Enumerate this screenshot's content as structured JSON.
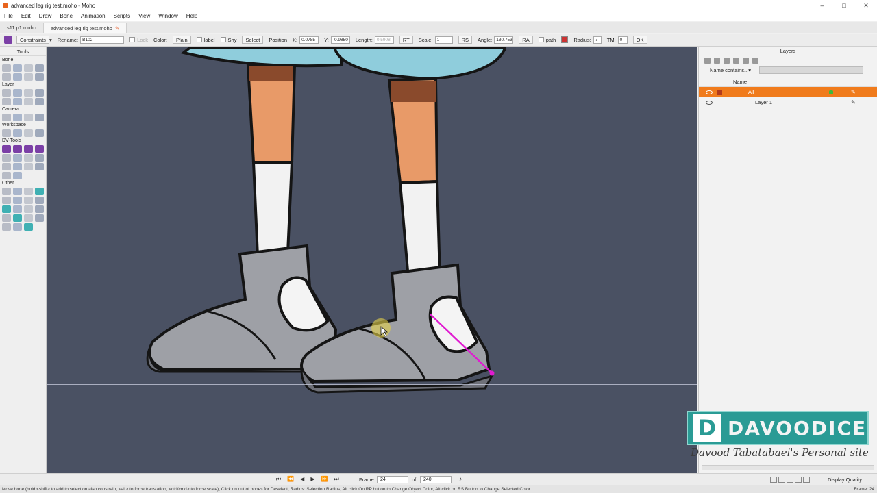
{
  "window": {
    "title": "advanced leg rig test.moho - Moho",
    "controls": {
      "minimize": "–",
      "maximize": "□",
      "close": "✕"
    }
  },
  "menu": [
    "File",
    "Edit",
    "Draw",
    "Bone",
    "Animation",
    "Scripts",
    "View",
    "Window",
    "Help"
  ],
  "tabs": [
    {
      "label": "s11 p1.moho",
      "active": false
    },
    {
      "label": "advanced leg rig test.moho",
      "active": true
    }
  ],
  "options": {
    "constraints": "Constraints",
    "rename_label": "Rename:",
    "rename_value": "B102",
    "lock": "Lock",
    "color_label": "Color:",
    "color_value": "Plain",
    "label": "label",
    "shy": "Shy",
    "select": "Select",
    "position_label": "Position",
    "x_label": "X:",
    "x_value": "0.0785",
    "y_label": "Y:",
    "y_value": "-0.9850",
    "length_label": "Length:",
    "length_value": "0.5908",
    "rt": "RT",
    "scale_label": "Scale:",
    "scale_value": "1",
    "rs": "RS",
    "angle_label": "Angle:",
    "angle_value": "130.753",
    "ra": "RA",
    "path": "path",
    "radius_label": "Radius:",
    "radius_value": "7",
    "tm_label": "TM:",
    "tm_value": "0",
    "ok": "OK"
  },
  "tools": {
    "header": "Tools",
    "sections": [
      {
        "name": "Bone",
        "icons": [
          "bone-select-icon",
          "bone-translate-icon",
          "bone-scale-icon",
          "bone-rotate-icon",
          "bone-add-icon",
          "bone-reparent-icon",
          "bone-strength-icon",
          "bone-manipulate-icon"
        ]
      },
      {
        "name": "Layer",
        "icons": [
          "layer-select-icon",
          "layer-translate-icon",
          "layer-rotate-icon",
          "layer-scale-icon",
          "layer-shear-icon",
          "layer-flip-icon",
          "text-icon",
          "pencil-icon"
        ]
      },
      {
        "name": "Camera",
        "icons": [
          "camera-track-icon",
          "camera-zoom-icon",
          "camera-roll-icon",
          "camera-pan-icon"
        ]
      },
      {
        "name": "Workspace",
        "icons": [
          "hand-icon",
          "zoom-icon",
          "rotate-view-icon",
          "orbit-icon"
        ]
      },
      {
        "name": "DV-Tools",
        "icons": [
          "dv-tool-1-icon",
          "dv-tool-2-icon",
          "dv-tool-3-icon",
          "dv-tool-4-icon",
          "dv-tool-5-icon",
          "dv-tool-6-icon",
          "dv-tool-7-icon",
          "dv-tool-8-icon",
          "dv-tool-9-icon",
          "dv-tool-10-icon",
          "dv-tool-11-icon",
          "dv-tool-12-icon",
          "dv-tool-13-icon",
          "dv-tool-14-icon"
        ]
      },
      {
        "name": "Other",
        "icons": [
          "other-1-icon",
          "other-2-icon",
          "other-3-icon",
          "other-4-icon",
          "other-5-icon",
          "other-6-icon",
          "other-7-icon",
          "other-8-icon",
          "other-9-icon",
          "other-10-icon",
          "other-11-icon",
          "other-12-icon",
          "other-13-icon",
          "other-14-icon",
          "other-15-icon",
          "other-16-icon",
          "other-17-icon",
          "other-18-icon",
          "other-19-icon"
        ]
      }
    ]
  },
  "layers": {
    "header": "Layers",
    "filter_label": "Name contains...",
    "column_name": "Name",
    "rows": [
      {
        "name": "All",
        "selected": true
      },
      {
        "name": "Layer 1",
        "selected": false
      }
    ]
  },
  "watermark": {
    "letter": "D",
    "brand": "DAVOODICE",
    "tagline": "Davood Tabatabaei's Personal site"
  },
  "timeline": {
    "frame_label": "Frame",
    "frame_value": "24",
    "of_label": "of",
    "total_value": "240",
    "display_quality": "Display Quality"
  },
  "status": {
    "text": "Move bone (hold <shift> to add to selection also constrain, <alt> to force translation, <ctrl/cmd> to force scale), Click on out of bones for Deselect, Radius: Selection Radius, Alt click On RP button to Change Object Color, Alt click on RS Button to Change Selected Color",
    "frame": "Frame: 24"
  },
  "colors": {
    "canvas_bg": "#4a5163",
    "selected_layer": "#f07b1c",
    "bone_selected": "#e01bd0",
    "shorts": "#8fcddc",
    "skin": "#e89a68",
    "sock": "#f2f2f2",
    "shoe": "#9ea0a6",
    "watermark": "#2a9b95"
  }
}
